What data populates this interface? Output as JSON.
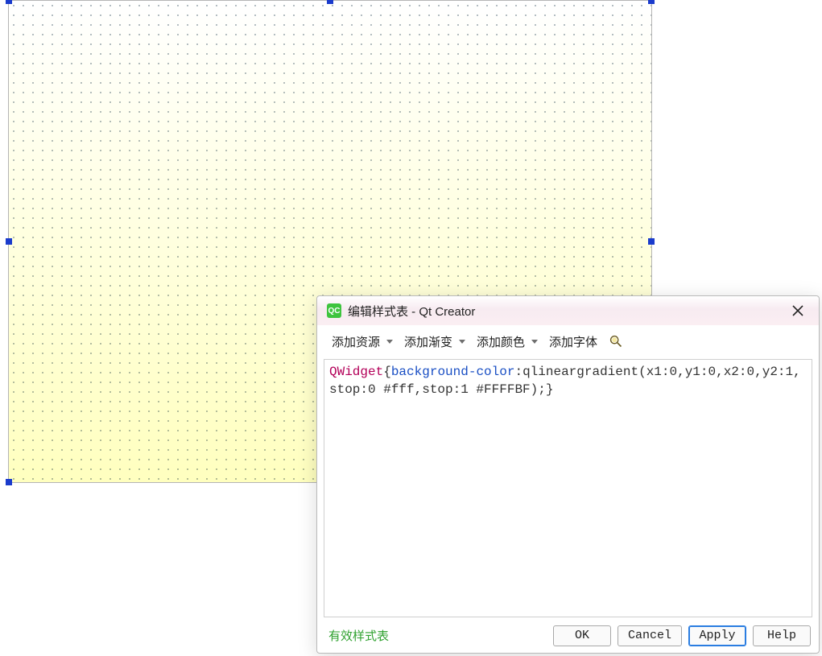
{
  "dialog": {
    "app_icon_text": "QC",
    "title": "编辑样式表 - Qt Creator",
    "toolbar": {
      "add_resource": "添加资源",
      "add_gradient": "添加渐变",
      "add_color": "添加颜色",
      "add_font": "添加字体"
    },
    "code": {
      "selector": "QWidget",
      "open_brace": "{",
      "property": "background-color",
      "colon": ":",
      "value": "qlineargradient(x1:0,y1:0,x2:0,y2:1,stop:0 #fff,stop:1 #FFFFBF);",
      "close_brace": "}"
    },
    "valid_label": "有效样式表",
    "buttons": {
      "ok": "OK",
      "cancel": "Cancel",
      "apply": "Apply",
      "help": "Help"
    }
  }
}
